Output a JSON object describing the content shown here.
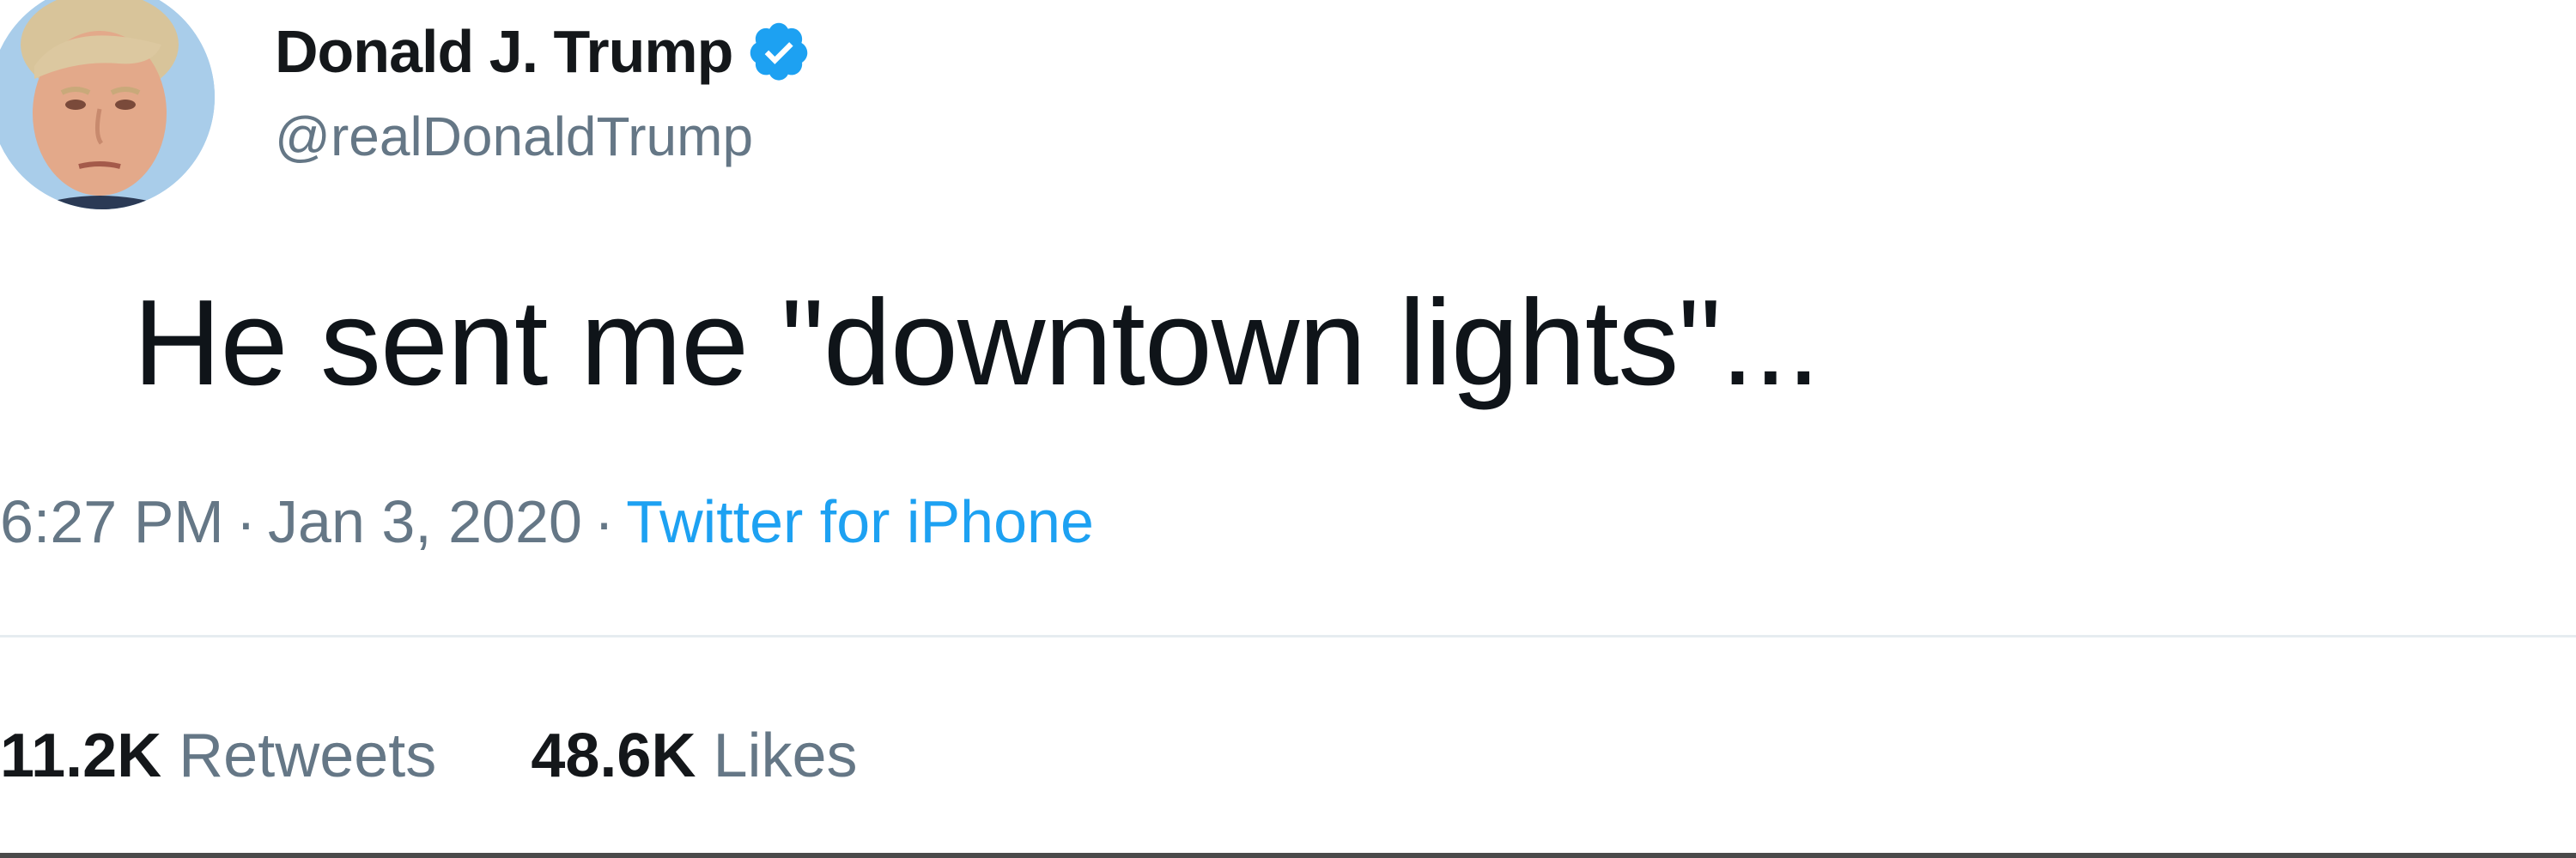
{
  "author": {
    "display_name": "Donald J. Trump",
    "handle": "@realDonaldTrump",
    "verified": true,
    "avatar_icon": "profile-photo",
    "verified_icon": "verified-badge-icon"
  },
  "tweet": {
    "text": "He sent me \"downtown lights\"..."
  },
  "meta": {
    "time": "6:27 PM",
    "separator": "·",
    "date": "Jan 3, 2020",
    "source": "Twitter for iPhone"
  },
  "stats": {
    "retweets_count": "11.2K",
    "retweets_label": "Retweets",
    "likes_count": "48.6K",
    "likes_label": "Likes"
  },
  "colors": {
    "text": "#14171a",
    "secondary": "#657786",
    "accent": "#1da1f2",
    "divider": "#e6ecf0"
  }
}
